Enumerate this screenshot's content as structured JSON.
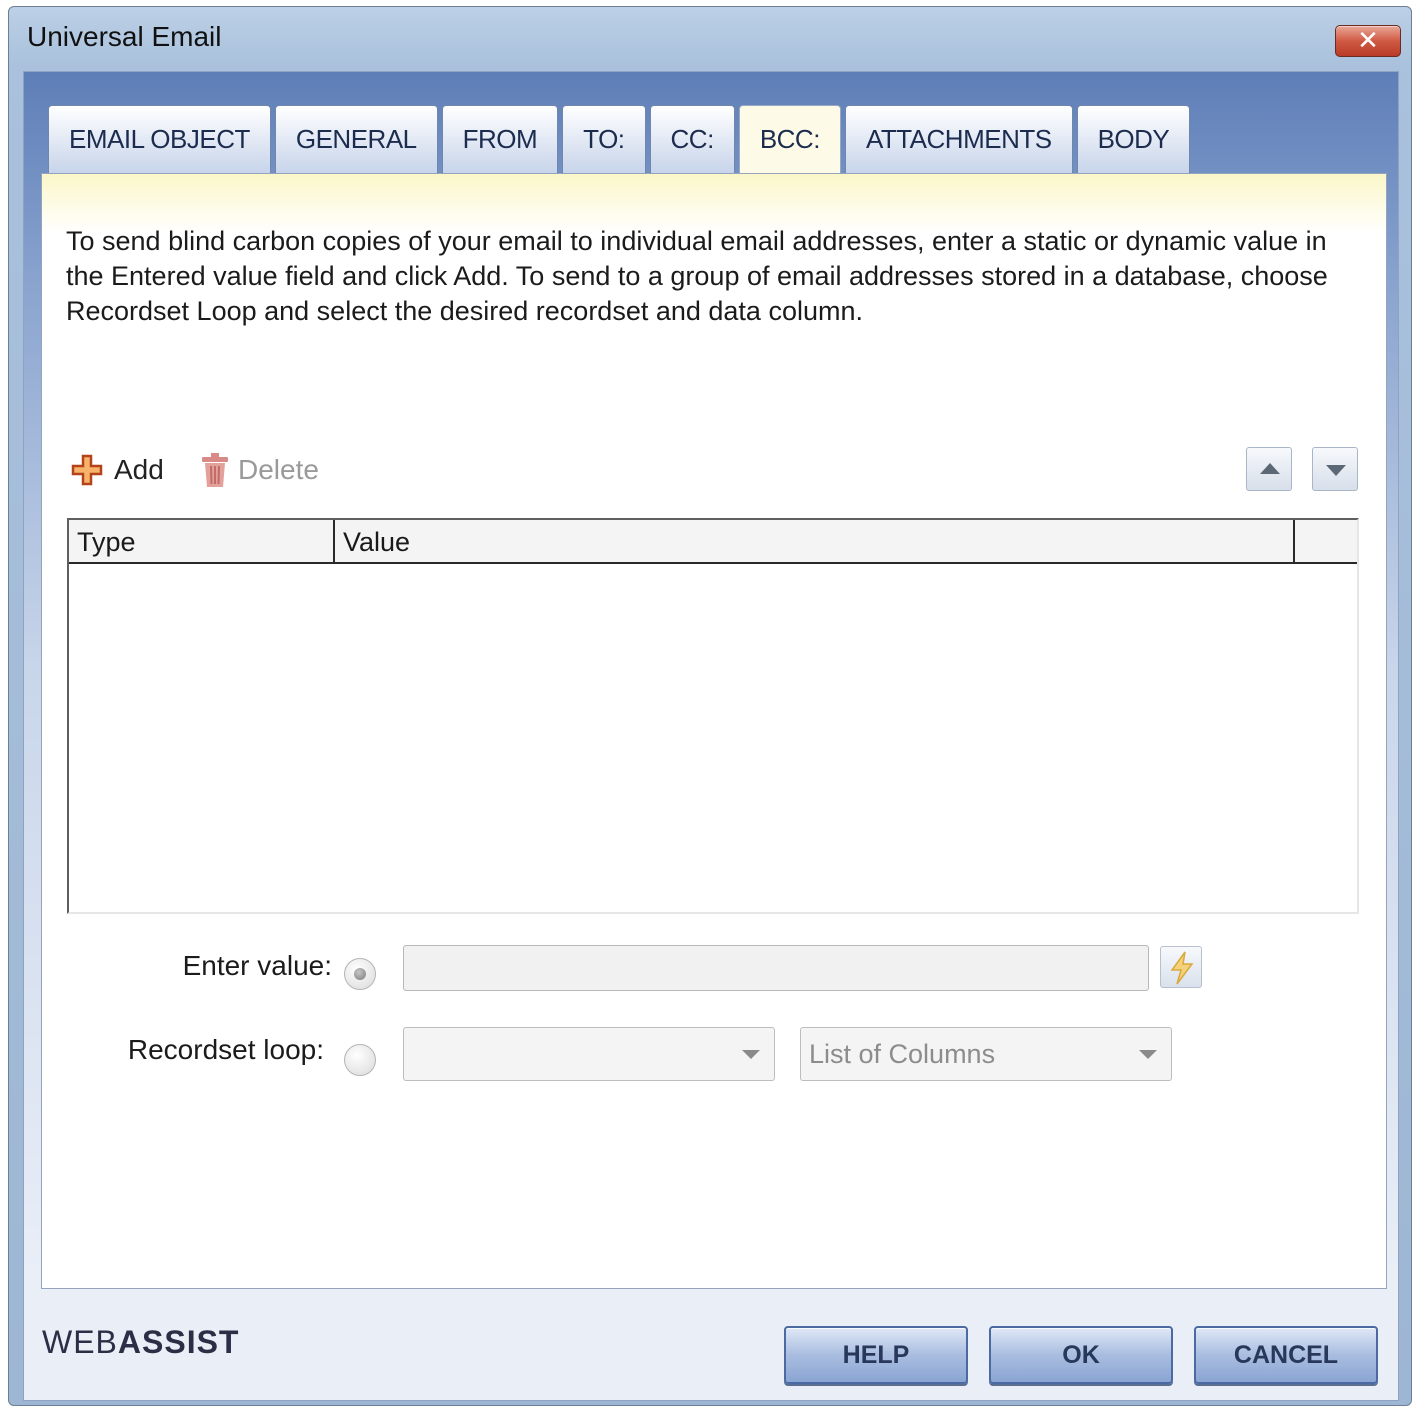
{
  "window": {
    "title": "Universal Email",
    "close_glyph": "✕"
  },
  "tabs": [
    {
      "label": "EMAIL OBJECT",
      "active": false
    },
    {
      "label": "GENERAL",
      "active": false
    },
    {
      "label": "FROM",
      "active": false
    },
    {
      "label": "TO:",
      "active": false
    },
    {
      "label": "CC:",
      "active": false
    },
    {
      "label": "BCC:",
      "active": true
    },
    {
      "label": "ATTACHMENTS",
      "active": false
    },
    {
      "label": "BODY",
      "active": false
    }
  ],
  "bcc": {
    "description": "To send blind carbon copies of your email to individual email addresses, enter a static or dynamic value in the Entered value field and click Add. To send to a group of email addresses stored in a database, choose Recordset Loop and select the desired recordset and data column.",
    "add_label": "Add",
    "delete_label": "Delete",
    "grid": {
      "columns": [
        "Type",
        "Value"
      ],
      "rows": []
    },
    "enter_value_label": "Enter value:",
    "enter_value_value": "",
    "recordset_loop_label": "Recordset loop:",
    "recordset_value": "",
    "columns_value": "List of Columns"
  },
  "footer": {
    "brand_prefix": "WEB",
    "brand_suffix": "ASSIST",
    "help_label": "HELP",
    "ok_label": "OK",
    "cancel_label": "CANCEL"
  }
}
